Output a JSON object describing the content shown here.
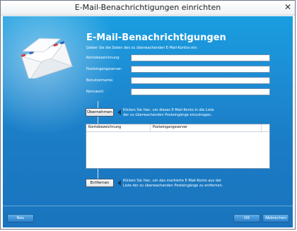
{
  "window": {
    "title": "E-Mail-Benachrichtigungen einrichten",
    "close_glyph": "✕"
  },
  "main": {
    "heading": "E-Mail-Benachrichtigungen",
    "description": "Geben Sie die Daten des zu überwachenden E-Mail-Kontos ein:",
    "icon": "envelope-icon"
  },
  "form": {
    "fields": [
      {
        "label": "Kontobezeichnung:",
        "value": ""
      },
      {
        "label": "Posteingangsserver:",
        "value": ""
      },
      {
        "label": "Benutzername:",
        "value": ""
      },
      {
        "label": "Kennwort:",
        "value": ""
      }
    ]
  },
  "add": {
    "button_label": "Übernehmen",
    "hint_line1": "Klicken Sie hier, um dieses E-Mail-Konto in die Liste",
    "hint_line2": "der zu überwachenden Posteingänge einzutragen."
  },
  "list": {
    "columns": [
      "Kontobezeichnung",
      "Posteingangsserver"
    ],
    "rows": []
  },
  "remove": {
    "button_label": "Entfernen",
    "hint_line1": "Klicken Sie hier, um das markierte E-Mail-Konto aus der",
    "hint_line2": "Liste der zu überwachenden Posteingänge zu entfernen."
  },
  "footer": {
    "new_label": "Neu",
    "ok_label": "OK",
    "cancel_label": "Abbrechen"
  },
  "colors": {
    "background_top": "#1a9ee0",
    "background_bottom": "#1a74be",
    "accent_button": "#2a7ec8"
  }
}
